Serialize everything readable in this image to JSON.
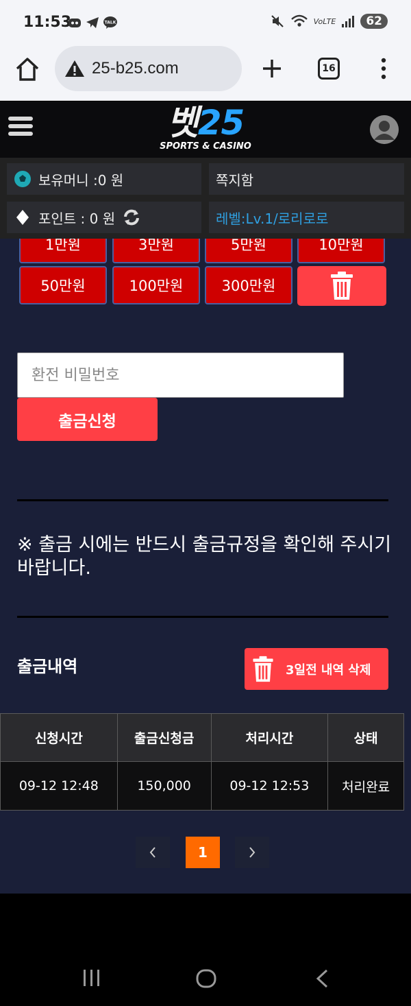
{
  "status_bar": {
    "time": "11:53",
    "network": "VoLTE",
    "battery": "62"
  },
  "browser": {
    "url": "25-b25.com",
    "tab_count": "16"
  },
  "site": {
    "logo_korean": "벳",
    "logo_number": "25",
    "logo_sub": "SPORTS & CASINO"
  },
  "info": {
    "money": "보유머니 :0 원",
    "message": "쪽지함",
    "points": "포인트 :  0 원",
    "level": "레벨:Lv.1/로리로로"
  },
  "amount_buttons": [
    {
      "label": "1만원"
    },
    {
      "label": "3만원"
    },
    {
      "label": "5만원"
    },
    {
      "label": "10만원"
    },
    {
      "label": "50만원"
    },
    {
      "label": "100만원"
    },
    {
      "label": "300만원"
    }
  ],
  "form": {
    "password_placeholder": "환전 비밀번호",
    "submit_label": "출금신청"
  },
  "notice": "※ 출금 시에는 반드시 출금규정을 확인해 주시기 바랍니다.",
  "history": {
    "title": "출금내역",
    "delete_label": "3일전 내역 삭제",
    "headers": [
      "신청시간",
      "출금신청금",
      "처리시간",
      "상태"
    ],
    "rows": [
      [
        "09-12 12:48",
        "150,000",
        "09-12 12:53",
        "처리완료"
      ]
    ]
  },
  "pagination": {
    "current": "1"
  },
  "colors": {
    "accent_red": "#ff3f45",
    "amount_red": "#cf0000",
    "content_bg": "#1a1f38",
    "page_active": "#ff6a00",
    "logo_blue": "#29a4ff"
  }
}
